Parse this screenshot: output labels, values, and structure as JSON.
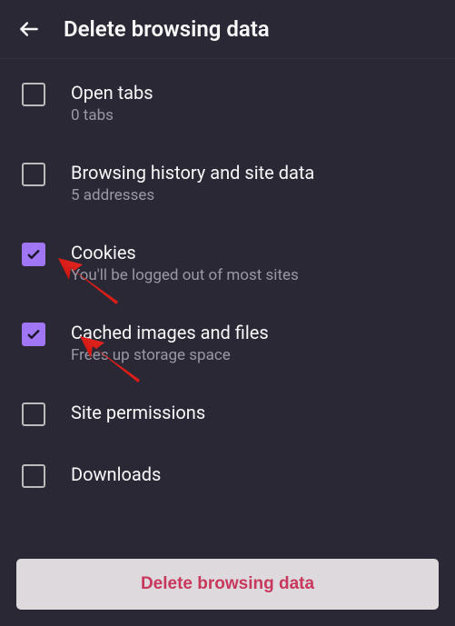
{
  "header": {
    "title": "Delete browsing data"
  },
  "items": [
    {
      "title": "Open tabs",
      "subtitle": "0 tabs",
      "checked": false
    },
    {
      "title": "Browsing history and site data",
      "subtitle": "5 addresses",
      "checked": false
    },
    {
      "title": "Cookies",
      "subtitle": "You'll be logged out of most sites",
      "checked": true
    },
    {
      "title": "Cached images and files",
      "subtitle": "Frees up storage space",
      "checked": true
    },
    {
      "title": "Site permissions",
      "subtitle": "",
      "checked": false
    },
    {
      "title": "Downloads",
      "subtitle": "",
      "checked": false
    }
  ],
  "footer": {
    "button_label": "Delete browsing data"
  }
}
